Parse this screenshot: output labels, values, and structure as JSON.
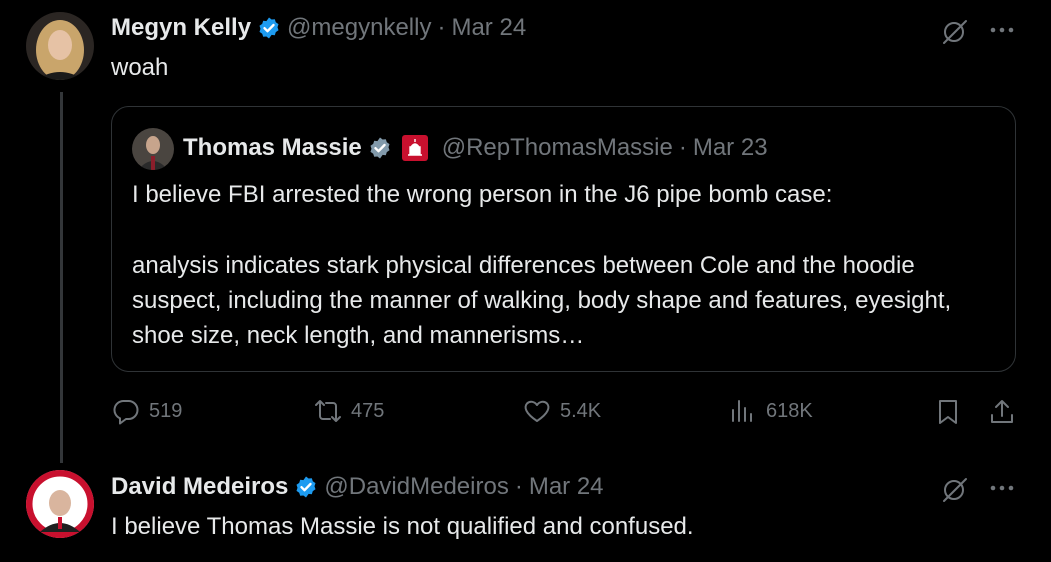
{
  "tweet1": {
    "name": "Megyn Kelly",
    "handle": "@megynkelly",
    "sep": "·",
    "date": "Mar 24",
    "text": "woah"
  },
  "quote": {
    "name": "Thomas Massie",
    "handle": "@RepThomasMassie",
    "sep": "·",
    "date": "Mar 23",
    "line1": "I believe FBI arrested the wrong person in the J6 pipe bomb case:",
    "para2": "analysis indicates stark physical differences between Cole and the hoodie suspect, including the manner of walking, body shape and features, eyesight, shoe size, neck length, and mannerisms…"
  },
  "actions": {
    "replies": "519",
    "reposts": "475",
    "likes": "5.4K",
    "views": "618K"
  },
  "tweet2": {
    "name": "David Medeiros",
    "handle": "@DavidMedeiros",
    "sep": "·",
    "date": "Mar 24",
    "text": "I believe Thomas Massie is not qualified and confused."
  },
  "colors": {
    "background": "#000000",
    "text": "#e7e9ea",
    "secondary": "#71767b",
    "verified_blue": "#1d9bf0",
    "verified_gray": "#829aab",
    "border": "#2f3336"
  },
  "icons": [
    "grok-icon",
    "more-icon",
    "reply-icon",
    "repost-icon",
    "like-icon",
    "views-icon",
    "bookmark-icon",
    "share-icon",
    "verified-badge-icon",
    "capitol-icon"
  ]
}
